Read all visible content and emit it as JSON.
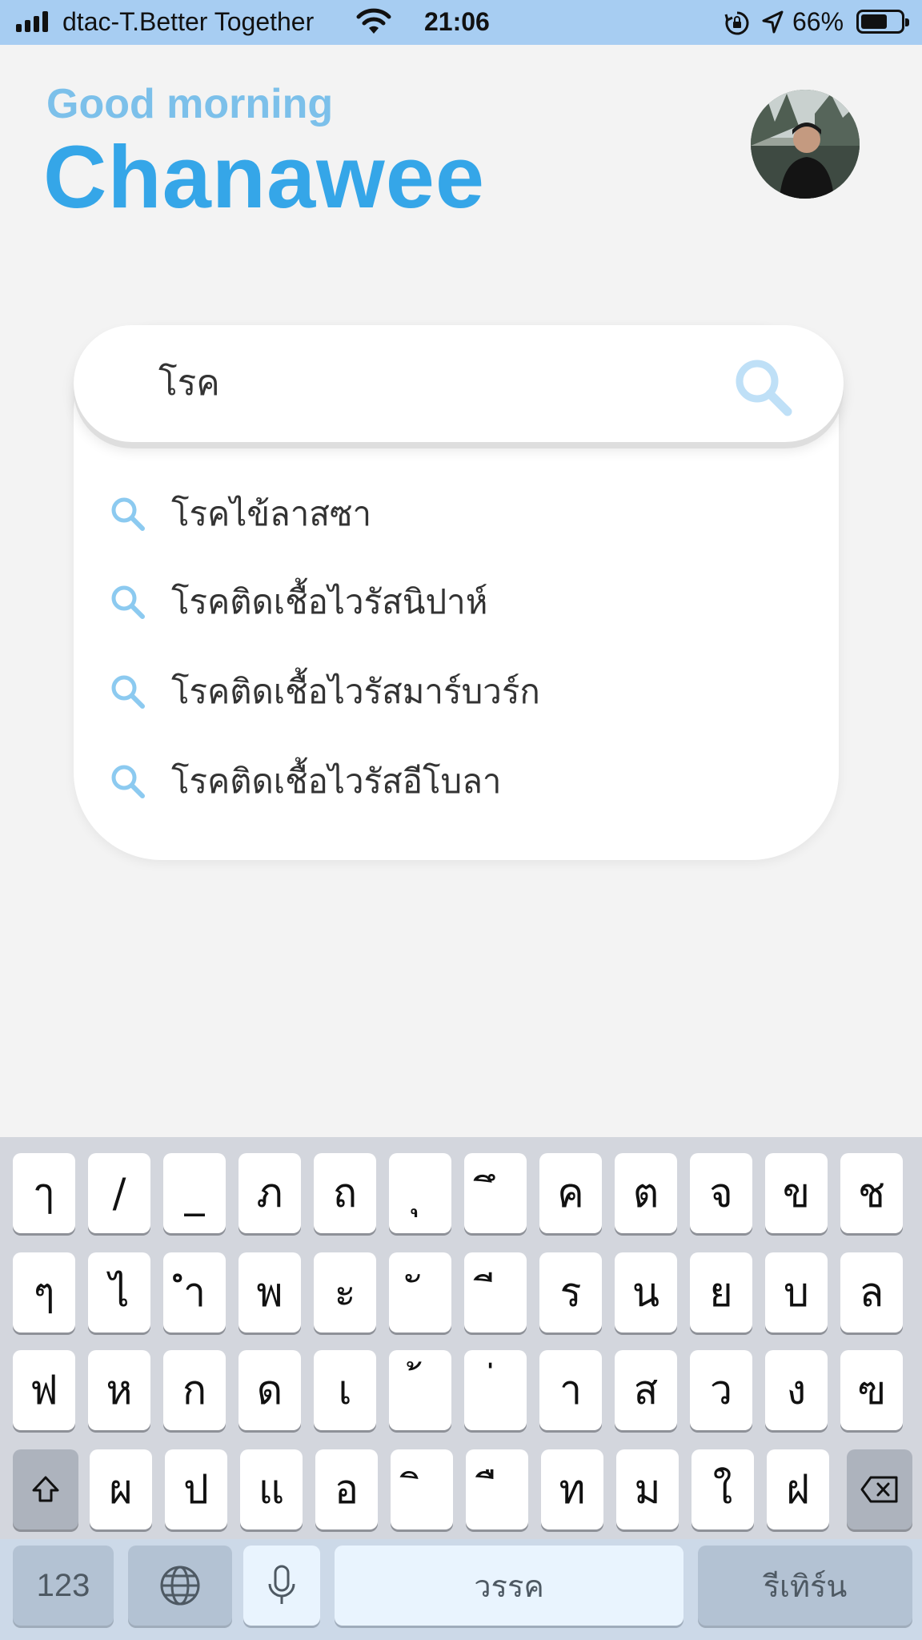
{
  "status_bar": {
    "carrier": "dtac-T.Better Together",
    "time": "21:06",
    "battery_percent": "66%",
    "battery_level": 0.66,
    "icons": [
      "signal-icon",
      "wifi-icon",
      "orientation-lock-icon",
      "location-arrow-icon",
      "battery-icon"
    ]
  },
  "header": {
    "greeting": "Good morning",
    "user_name": "Chanawee",
    "avatar": "profile-photo"
  },
  "search": {
    "query": "โรค",
    "icon": "search-icon",
    "accent_color": "#bfe0f7",
    "suggestions": [
      "โรคไข้ลาสซา",
      "โรคติดเชื้อไวรัสนิปาห์",
      "โรคติดเชื้อไวรัสมาร์บวร์ก",
      "โรคติดเชื้อไวรัสอีโบลา"
    ]
  },
  "keyboard": {
    "rows": [
      [
        "ๅ",
        "/",
        "_",
        "ภ",
        "ถ",
        "ุ",
        "ึ",
        "ค",
        "ต",
        "จ",
        "ข",
        "ช"
      ],
      [
        "ๆ",
        "ไ",
        "ำ",
        "พ",
        "ะ",
        "ั",
        "ี",
        "ร",
        "น",
        "ย",
        "บ",
        "ล"
      ],
      [
        "ฟ",
        "ห",
        "ก",
        "ด",
        "เ",
        "้",
        "่",
        "า",
        "ส",
        "ว",
        "ง",
        "ฃ"
      ],
      [
        "ผ",
        "ป",
        "แ",
        "อ",
        "ิ",
        "ื",
        "ท",
        "ม",
        "ใ",
        "ฝ"
      ]
    ],
    "shift_icon": "shift-arrow-icon",
    "delete_icon": "backspace-icon",
    "numbers_label": "123",
    "globe_icon": "globe-icon",
    "mic_icon": "microphone-icon",
    "space_label": "วรรค",
    "return_label": "รีเทิร์น"
  },
  "colors": {
    "status_bar_bg": "#a7cdf2",
    "greeting": "#7cc0ea",
    "name": "#35a6e8",
    "background": "#f3f3f3",
    "keyboard_bg": "#d3d6dd"
  }
}
